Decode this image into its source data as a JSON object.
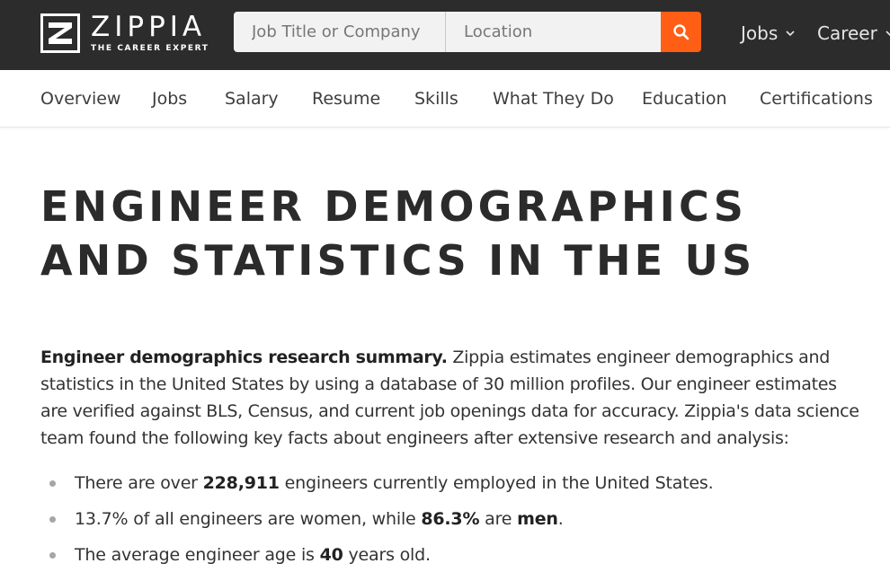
{
  "brand": {
    "name": "ZIPPIA",
    "tagline": "THE CAREER EXPERT"
  },
  "search": {
    "job_placeholder": "Job Title or Company",
    "location_placeholder": "Location",
    "button_icon": "search-icon"
  },
  "top_nav": [
    {
      "label": "Jobs",
      "icon": "chevron-down-icon"
    },
    {
      "label": "Career",
      "icon": "chevron-down-icon"
    }
  ],
  "sub_nav": [
    "Overview",
    "Jobs",
    "Salary",
    "Resume",
    "Skills",
    "What They Do",
    "Education",
    "Certifications"
  ],
  "page": {
    "title": "ENGINEER DEMOGRAPHICS AND STATISTICS IN THE US",
    "summary_lead": "Engineer demographics research summary.",
    "summary_body": " Zippia estimates engineer demographics and statistics in the United States by using a database of 30 million profiles. Our engineer estimates are verified against BLS, Census, and current job openings data for accuracy. Zippia's data science team found the following key facts about engineers after extensive research and analysis:"
  },
  "facts": [
    {
      "pre": "There are over ",
      "bold": "228,911",
      "post": " engineers currently employed in the United States."
    },
    {
      "pre": "13.7% of all engineers are women, while ",
      "bold": "86.3%",
      "mid": " are ",
      "bold2": "men",
      "post": "."
    },
    {
      "pre": "The average engineer age is ",
      "bold": "40",
      "post": " years old."
    }
  ],
  "colors": {
    "topbar": "#2c2c2c",
    "accent": "#ff5e14",
    "text": "#333333"
  }
}
